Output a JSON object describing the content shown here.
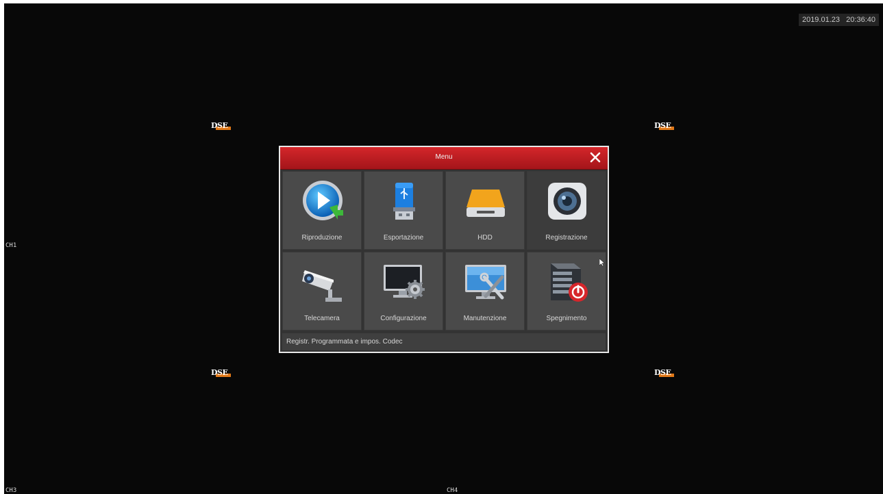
{
  "status_overlay": {
    "datetime": "2019.01.23   20:36:40"
  },
  "channels": {
    "ch1": "CH1",
    "ch3": "CH3",
    "ch4": "CH4"
  },
  "logo": {
    "text": "DSE",
    "accent_color": "#e07818"
  },
  "menu": {
    "title": "Menu",
    "close_label": "×",
    "header_color": "#c41f24",
    "items": [
      {
        "label": "Riproduzione",
        "icon": "play-icon"
      },
      {
        "label": "Esportazione",
        "icon": "usb-drive-icon"
      },
      {
        "label": "HDD",
        "icon": "hard-disk-icon"
      },
      {
        "label": "Registrazione",
        "icon": "camera-lens-icon",
        "selected": true
      },
      {
        "label": "Telecamera",
        "icon": "cctv-camera-icon"
      },
      {
        "label": "Configurazione",
        "icon": "monitor-gear-icon"
      },
      {
        "label": "Manutenzione",
        "icon": "monitor-tools-icon"
      },
      {
        "label": "Spegnimento",
        "icon": "server-power-icon"
      }
    ],
    "status_text": "Registr. Programmata e impos. Codec"
  }
}
